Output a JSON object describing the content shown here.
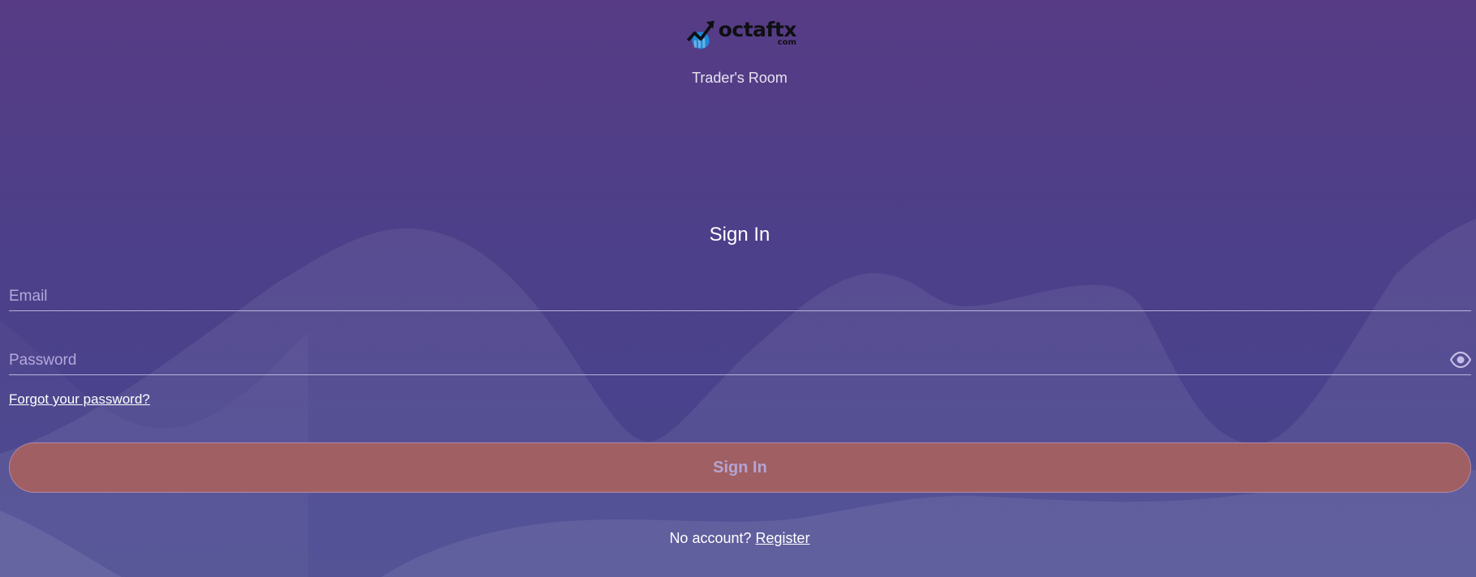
{
  "brand": {
    "logo_word": "octaftx",
    "logo_domain": "com",
    "subtitle": "Trader's Room"
  },
  "form": {
    "heading": "Sign In",
    "email_placeholder": "Email",
    "password_placeholder": "Password",
    "forgot_link": "Forgot your password?",
    "submit_label": "Sign In"
  },
  "footer": {
    "no_account_text": "No account?",
    "register_link": "Register"
  },
  "colors": {
    "background_top": "#573c85",
    "background_bottom": "#46468f",
    "button_background": "#a05f62",
    "button_text": "#b4a4d4",
    "logo_blue": "#1e88d9"
  },
  "icons": {
    "password_toggle": "eye-icon",
    "logo_mark": "bar-chart-arrow-icon"
  }
}
